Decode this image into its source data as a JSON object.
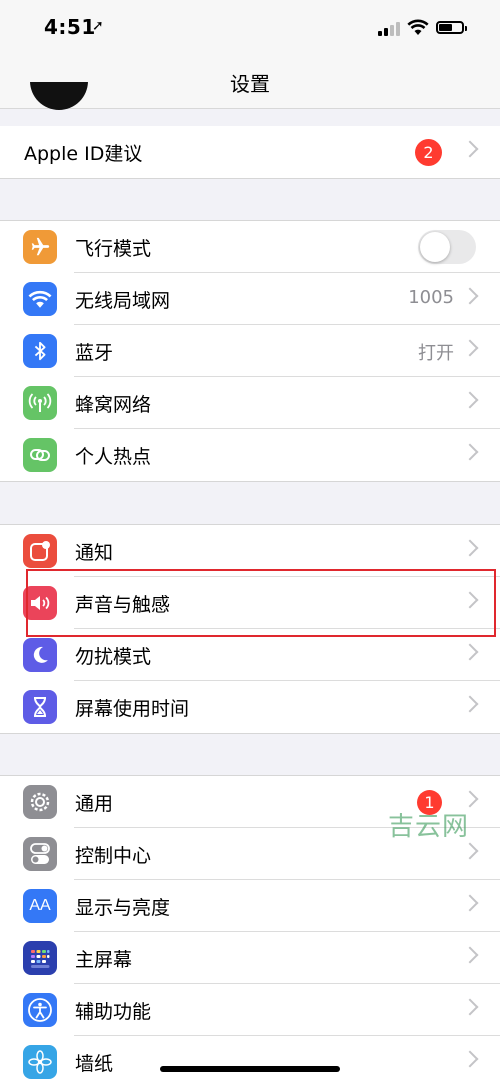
{
  "status": {
    "time": "4:51"
  },
  "nav": {
    "title": "设置"
  },
  "apple_id": {
    "label": "Apple ID建议",
    "badge": "2"
  },
  "connectivity": [
    {
      "label": "飞行模式",
      "icon": "airplane-icon",
      "color": "#f09a37",
      "toggle": "off"
    },
    {
      "label": "无线局域网",
      "value": "1005",
      "icon": "wifi-icon",
      "color": "#3478f6"
    },
    {
      "label": "蓝牙",
      "value": "打开",
      "icon": "bluetooth-icon",
      "color": "#3478f6"
    },
    {
      "label": "蜂窝网络",
      "icon": "cellular-antenna-icon",
      "color": "#65c466"
    },
    {
      "label": "个人热点",
      "icon": "hotspot-link-icon",
      "color": "#65c466"
    }
  ],
  "notifications_group": [
    {
      "label": "通知",
      "icon": "notifications-icon",
      "color": "#eb4d3d"
    },
    {
      "label": "声音与触感",
      "icon": "speaker-icon",
      "color": "#eb445a"
    },
    {
      "label": "勿扰模式",
      "icon": "moon-icon",
      "color": "#5e5ce6"
    },
    {
      "label": "屏幕使用时间",
      "icon": "hourglass-icon",
      "color": "#5e5ce6"
    }
  ],
  "general_group": [
    {
      "label": "通用",
      "badge": "1",
      "icon": "gear-icon",
      "color": "#8e8e93"
    },
    {
      "label": "控制中心",
      "icon": "toggles-icon",
      "color": "#8e8e93"
    },
    {
      "label": "显示与亮度",
      "icon": "text-size-icon",
      "color": "#3478f6"
    },
    {
      "label": "主屏幕",
      "icon": "home-grid-icon",
      "color": "#2b3fae"
    },
    {
      "label": "辅助功能",
      "icon": "accessibility-icon",
      "color": "#3478f6"
    },
    {
      "label": "墙纸",
      "icon": "flower-icon",
      "color": "#36a5e6"
    }
  ],
  "watermark": {
    "text": "吉云网"
  }
}
